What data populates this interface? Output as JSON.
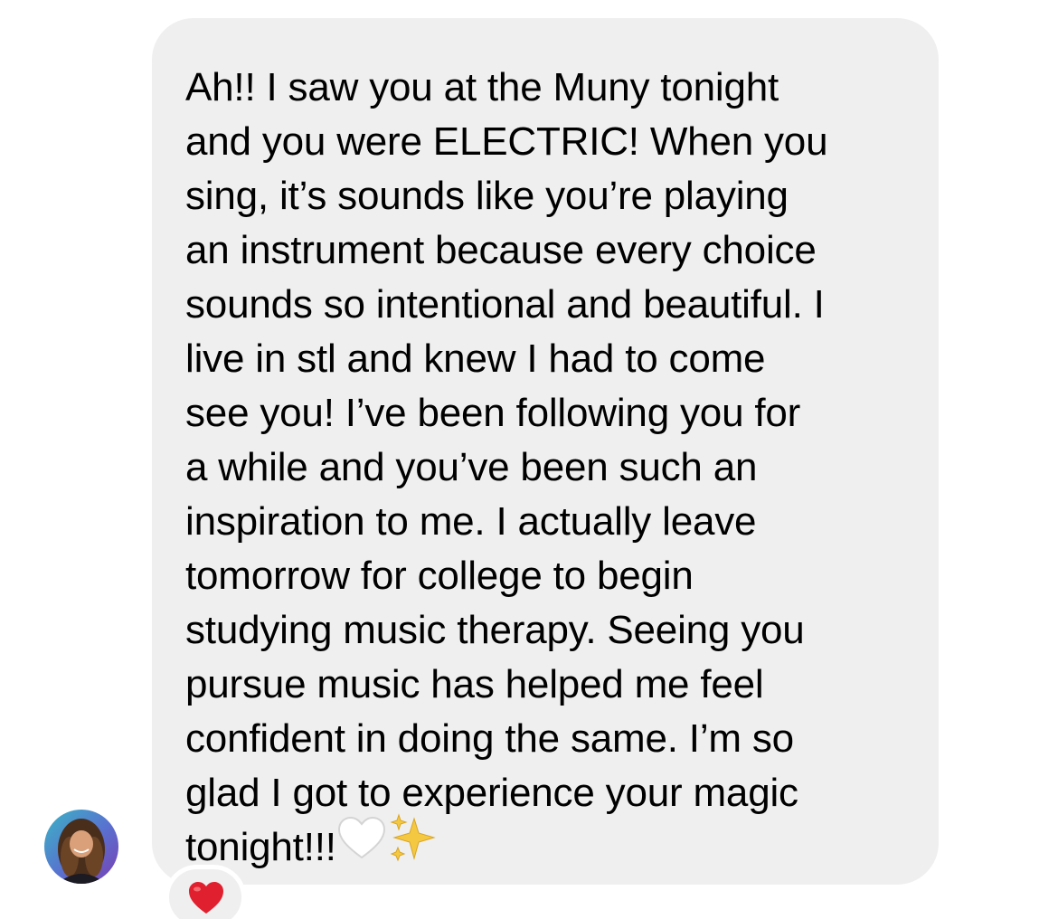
{
  "conversation": {
    "message": {
      "lines": [
        "Ah!! I saw you at the Muny tonight",
        "and you were ELECTRIC! When you",
        "sing, it’s sounds like you’re playing",
        "an instrument because every choice",
        "sounds so intentional and beautiful. I",
        "live in stl and knew I had to come",
        "see you! I’ve been following you for",
        "a while and you’ve been such an",
        "inspiration to me. I actually leave",
        "tomorrow for college to begin",
        "studying music therapy. Seeing you",
        "pursue music has helped me feel",
        "confident in doing the same. I’m so",
        "glad I got to experience your magic"
      ],
      "last_line": "tonight!!!",
      "trailing_emojis": [
        "white-heart",
        "sparkles"
      ],
      "reaction": "red-heart"
    },
    "colors": {
      "bubble": "#efefef",
      "text": "#000000",
      "reaction_heart": "#e0202f"
    }
  }
}
